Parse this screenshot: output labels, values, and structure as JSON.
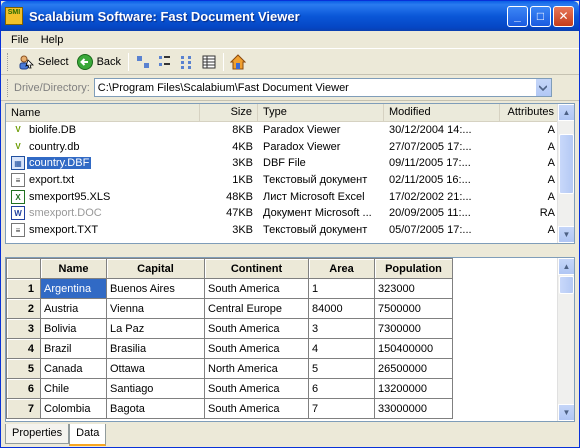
{
  "window": {
    "title": "Scalabium Software: Fast Document Viewer",
    "app_icon_text": "SMI",
    "buttons": [
      "_",
      "□",
      "✕"
    ]
  },
  "menu": [
    "File",
    "Help"
  ],
  "toolbar": {
    "select_label": "Select",
    "back_label": "Back"
  },
  "drive": {
    "label": "Drive/Directory:",
    "value": "C:\\Program Files\\Scalabium\\Fast Document Viewer"
  },
  "filelist": {
    "headers": [
      "Name",
      "Size",
      "Type",
      "Modified",
      "Attributes"
    ],
    "rows": [
      {
        "name": "biolife.DB",
        "size": "8KB",
        "type": "Paradox Viewer",
        "modified": "30/12/2004 14:...",
        "attr": "A",
        "icon": "paradox-icon"
      },
      {
        "name": "country.db",
        "size": "4KB",
        "type": "Paradox Viewer",
        "modified": "27/07/2005 17:...",
        "attr": "A",
        "icon": "paradox-icon"
      },
      {
        "name": "country.DBF",
        "size": "3KB",
        "type": "DBF File",
        "modified": "09/11/2005 17:...",
        "attr": "A",
        "icon": "dbf-icon"
      },
      {
        "name": "export.txt",
        "size": "1KB",
        "type": "Текстовый документ",
        "modified": "02/11/2005 16:...",
        "attr": "A",
        "icon": "text-file-icon"
      },
      {
        "name": "smexport95.XLS",
        "size": "48KB",
        "type": "Лист Microsoft Excel",
        "modified": "17/02/2002 21:...",
        "attr": "A",
        "icon": "excel-icon"
      },
      {
        "name": "smexport.DOC",
        "size": "47KB",
        "type": "Документ Microsoft ...",
        "modified": "20/09/2005 11:...",
        "attr": "RA",
        "icon": "word-icon"
      },
      {
        "name": "smexport.TXT",
        "size": "3KB",
        "type": "Текстовый документ",
        "modified": "05/07/2005 17:...",
        "attr": "A",
        "icon": "text-file-icon"
      }
    ]
  },
  "grid": {
    "headers": [
      "Name",
      "Capital",
      "Continent",
      "Area",
      "Population"
    ],
    "rows": [
      {
        "n": "1",
        "cells": [
          "Argentina",
          "Buenos Aires",
          "South America",
          "1",
          "323000"
        ]
      },
      {
        "n": "2",
        "cells": [
          "Austria",
          "Vienna",
          "Central Europe",
          "84000",
          "7500000"
        ]
      },
      {
        "n": "3",
        "cells": [
          "Bolivia",
          "La Paz",
          "South America",
          "3",
          "7300000"
        ]
      },
      {
        "n": "4",
        "cells": [
          "Brazil",
          "Brasilia",
          "South America",
          "4",
          "150400000"
        ]
      },
      {
        "n": "5",
        "cells": [
          "Canada",
          "Ottawa",
          "North America",
          "5",
          "26500000"
        ]
      },
      {
        "n": "6",
        "cells": [
          "Chile",
          "Santiago",
          "South America",
          "6",
          "13200000"
        ]
      },
      {
        "n": "7",
        "cells": [
          "Colombia",
          "Bagota",
          "South America",
          "7",
          "33000000"
        ]
      }
    ]
  },
  "tabs": [
    "Properties",
    "Data"
  ]
}
